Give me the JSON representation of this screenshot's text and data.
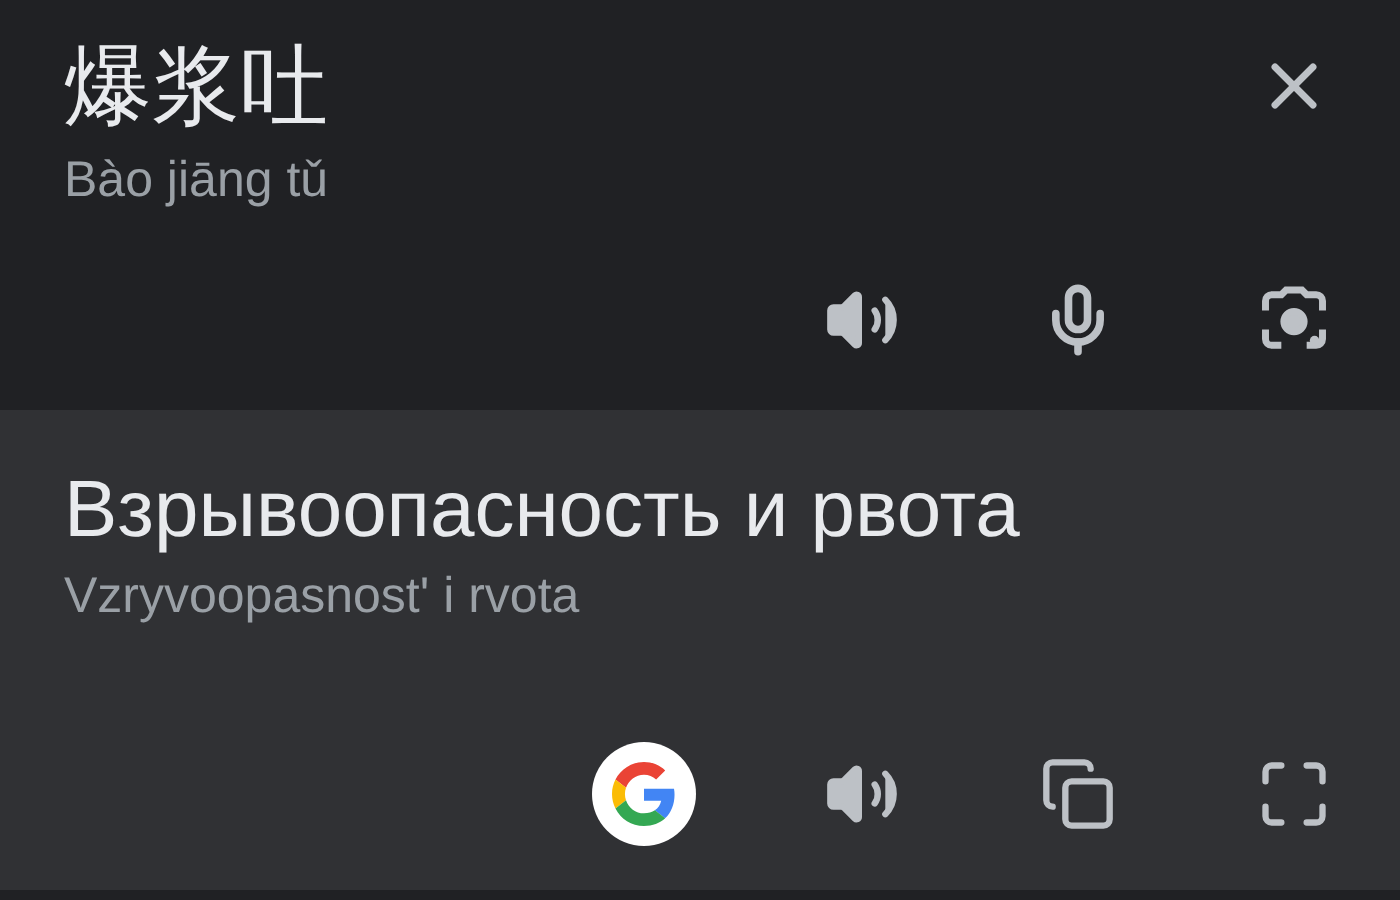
{
  "source": {
    "text": "爆浆吐",
    "romanization": "Bào jiāng tǔ"
  },
  "translation": {
    "text": "Взрывоопасность и рвота",
    "romanization": "Vzryvoopasnost' i rvota"
  }
}
